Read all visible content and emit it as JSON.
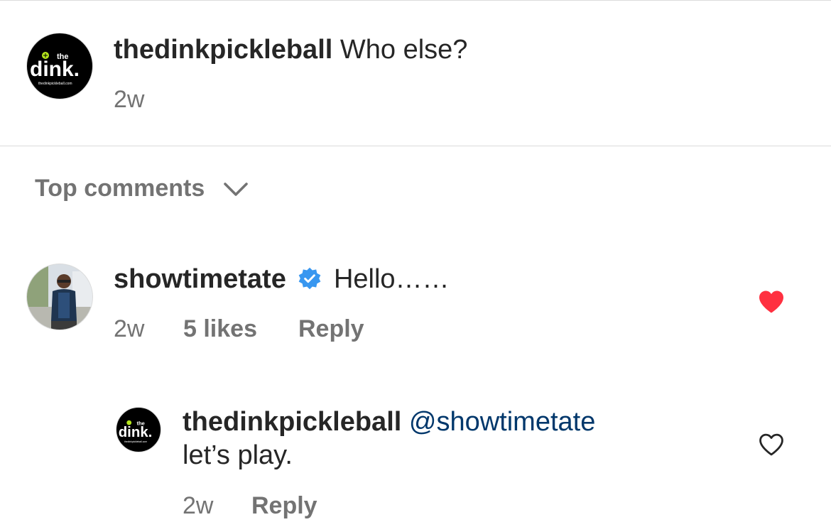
{
  "post": {
    "username": "thedinkpickleball",
    "caption": "Who else?",
    "time": "2w",
    "avatar": {
      "logo_text": "dink.",
      "logo_top": "the",
      "logo_url": "thedinkpickleball.com"
    }
  },
  "sort": {
    "label": "Top comments",
    "icon": "chevron-down-icon"
  },
  "comments": [
    {
      "username": "showtimetate",
      "verified": true,
      "text": "Hello……",
      "time": "2w",
      "likes": "5 likes",
      "reply": "Reply",
      "liked": true,
      "like_color": "#ff3040"
    }
  ],
  "replies": [
    {
      "username": "thedinkpickleball",
      "mention": "@showtimetate",
      "text": "let’s play.",
      "time": "2w",
      "reply": "Reply",
      "liked": false,
      "avatar": {
        "logo_text": "dink.",
        "logo_top": "the",
        "logo_url": "thedinkpickleball.com"
      }
    }
  ],
  "colors": {
    "mention": "#00376b",
    "verified": "#3897f0",
    "muted": "#737373"
  }
}
